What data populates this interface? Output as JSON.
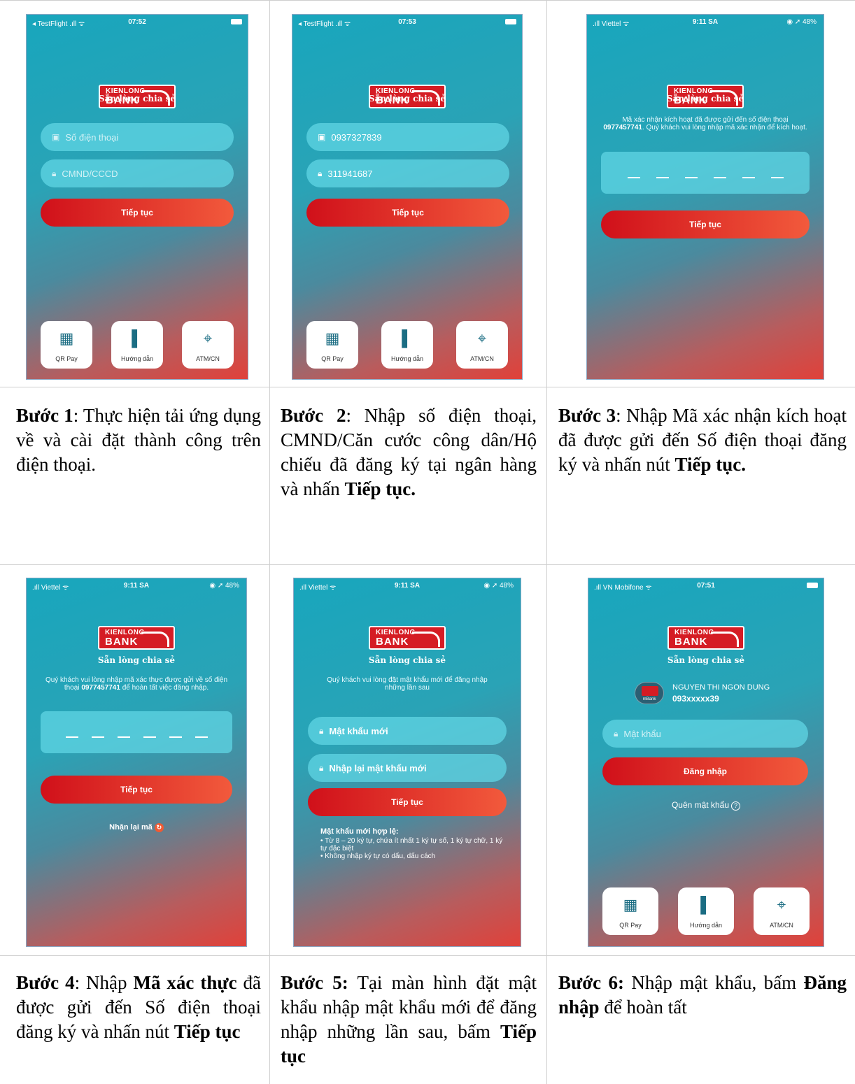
{
  "app": {
    "logo_top": "KIENLONG",
    "logo_bottom": "BANK",
    "slogan": "Sẵn lòng chia sẻ",
    "avatar_label": "mBank"
  },
  "colors": {
    "brand_red": "#d51c24",
    "teal": "#18a6bd",
    "button_red": "#e0241f"
  },
  "screens": {
    "s1": {
      "status_left": "◂ TestFlight .ıll ᯤ",
      "status_time": "07:52",
      "phone_placeholder": "Số điện thoại",
      "id_placeholder": "CMND/CCCD",
      "continue": "Tiếp tục",
      "cards": [
        "QR Pay",
        "Hướng dẫn",
        "ATM/CN"
      ]
    },
    "s2": {
      "status_left": "◂ TestFlight .ıll ᯤ",
      "status_time": "07:53",
      "phone_value": "0937327839",
      "id_value": "311941687",
      "continue": "Tiếp tục",
      "cards": [
        "QR Pay",
        "Hướng dẫn",
        "ATM/CN"
      ]
    },
    "s3": {
      "status_left": ".ıll Viettel ᯤ",
      "status_time": "9:11 SA",
      "status_right": "◉ ➚ 48%",
      "msg_part1": "Mã xác nhận kích hoạt đã được gửi đến số điện thoại ",
      "msg_phone": "0977457741",
      "msg_part2": ". Quý khách vui lòng nhập mã xác nhận để kích hoạt.",
      "continue": "Tiếp tục"
    },
    "s4": {
      "status_left": ".ıll Viettel ᯤ",
      "status_time": "9:11 SA",
      "status_right": "◉ ➚ 48%",
      "msg_part1": "Quý khách vui lòng nhập mã xác thực được gửi về số điện thoại ",
      "msg_phone": "0977457741",
      "msg_part2": " để hoàn tất việc đăng nhập.",
      "continue": "Tiếp tục",
      "resend": "Nhận lại mã"
    },
    "s5": {
      "status_left": ".ıll Viettel ᯤ",
      "status_time": "9:11 SA",
      "status_right": "◉ ➚ 48%",
      "msg": "Quý khách vui lòng đặt mật khẩu mới để đăng nhập những lần sau",
      "new_password": "Mật khẩu mới",
      "confirm_password": "Nhập lại mật khẩu mới",
      "continue": "Tiếp tục",
      "rules_title": "Mật khẩu mới hợp lệ:",
      "rule_1": "• Từ 8 – 20 ký tự, chứa ít nhất 1 ký tự số, 1 ký tự chữ, 1 ký tự đặc biệt",
      "rule_2": "• Không nhập ký tự có dấu, dấu cách"
    },
    "s6": {
      "status_left": ".ıll VN Mobifone ᯤ",
      "status_time": "07:51",
      "user_name": "NGUYEN THI NGON DUNG",
      "user_phone": "093xxxxx39",
      "password_placeholder": "Mật khẩu",
      "login": "Đăng nhập",
      "forgot": "Quên mật khẩu",
      "cards": [
        "QR Pay",
        "Hướng dẫn",
        "ATM/CN"
      ]
    }
  },
  "captions": {
    "c1": {
      "label": "Bước 1",
      "text": ": Thực hiện tải ứng dụng về và cài đặt thành công trên điện thoại."
    },
    "c2": {
      "label": "Bước 2",
      "text": ": Nhập số điện thoại, CMND/Căn cước công dân/Hộ chiếu đã đăng ký tại ngân hàng và nhấn ",
      "bold_end": "Tiếp tục."
    },
    "c3": {
      "label": "Bước 3",
      "text": ": Nhập Mã xác nhận kích hoạt đã được gửi đến Số điện thoại đăng ký và nhấn nút ",
      "bold_end": "Tiếp tục."
    },
    "c4": {
      "label": "Bước 4",
      "text1": ": Nhập ",
      "bold_mid": "Mã xác thực",
      "text2": " đã được gửi đến Số điện thoại đăng ký và nhấn nút ",
      "bold_end": "Tiếp tục"
    },
    "c5": {
      "label": "Bước 5:",
      "text": " Tại màn hình đặt mật khẩu nhập mật khẩu mới để đăng nhập những lần sau, bấm ",
      "bold_end": "Tiếp tục"
    },
    "c6": {
      "label": "Bước 6:",
      "text1": " Nhập mật khẩu, bấm ",
      "bold_mid": "Đăng nhập",
      "text2": " để hoàn tất"
    }
  }
}
